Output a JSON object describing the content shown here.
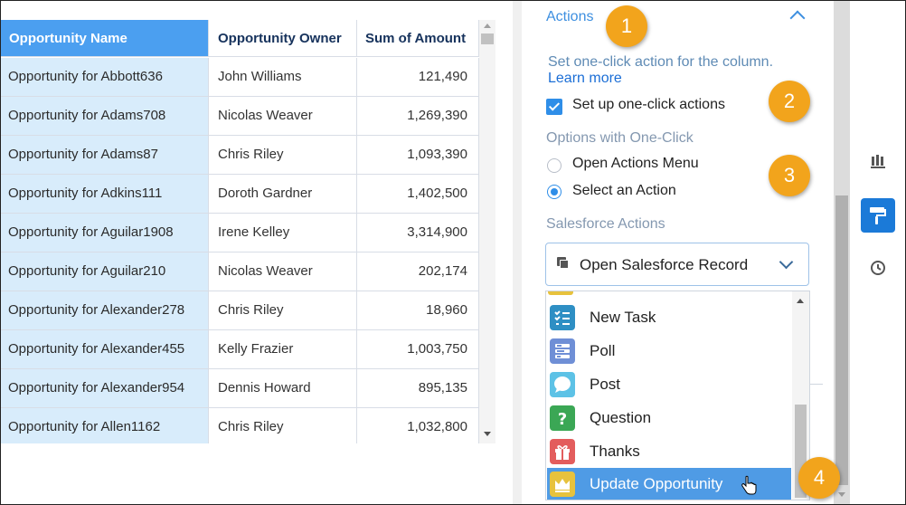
{
  "table": {
    "headers": [
      "Opportunity Name",
      "Opportunity Owner",
      "Sum of Amount"
    ],
    "rows": [
      [
        "Opportunity for Abbott636",
        "John Williams",
        "121,490"
      ],
      [
        "Opportunity for Adams708",
        "Nicolas Weaver",
        "1,269,390"
      ],
      [
        "Opportunity for Adams87",
        "Chris Riley",
        "1,093,390"
      ],
      [
        "Opportunity for Adkins111",
        "Doroth Gardner",
        "1,402,500"
      ],
      [
        "Opportunity for Aguilar1908",
        "Irene Kelley",
        "3,314,900"
      ],
      [
        "Opportunity for Aguilar210",
        "Nicolas Weaver",
        "202,174"
      ],
      [
        "Opportunity for Alexander278",
        "Chris Riley",
        "18,960"
      ],
      [
        "Opportunity for Alexander455",
        "Kelly Frazier",
        "1,003,750"
      ],
      [
        "Opportunity for Alexander954",
        "Dennis Howard",
        "895,135"
      ],
      [
        "Opportunity for Allen1162",
        "Chris Riley",
        "1,032,800"
      ]
    ]
  },
  "panel": {
    "section_title": "Actions",
    "description": "Set one-click action for the column.",
    "learn_more": "Learn more",
    "checkbox_label": "Set up one-click actions",
    "checkbox_checked": true,
    "options_label": "Options with One-Click",
    "radio_options": [
      "Open Actions Menu",
      "Select an Action"
    ],
    "radio_selected": "Select an Action",
    "salesforce_actions_label": "Salesforce Actions",
    "select_value": "Open Salesforce Record",
    "list_items": [
      {
        "label": "New Task",
        "icon": "task-icon",
        "color": "#2e8fc4"
      },
      {
        "label": "Poll",
        "icon": "poll-icon",
        "color": "#6f8fd6"
      },
      {
        "label": "Post",
        "icon": "post-icon",
        "color": "#5dc2e6"
      },
      {
        "label": "Question",
        "icon": "question-icon",
        "color": "#3ba755"
      },
      {
        "label": "Thanks",
        "icon": "thanks-icon",
        "color": "#e35d5d"
      },
      {
        "label": "Update Opportunity",
        "icon": "crown-icon",
        "color": "#e7c23d"
      }
    ],
    "selected_item": "Update Opportunity"
  },
  "toolbar": {
    "buttons": [
      "chart-icon",
      "paint-roller-icon",
      "clock-icon"
    ],
    "active": "paint-roller-icon"
  },
  "callouts": [
    "1",
    "2",
    "3",
    "4"
  ]
}
